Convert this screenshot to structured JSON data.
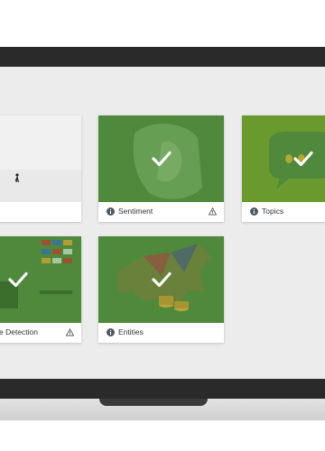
{
  "cards": [
    {
      "id": "scene",
      "label": "",
      "selected": false,
      "has_info": false,
      "has_warning": false
    },
    {
      "id": "sentiment",
      "label": "Sentiment",
      "selected": true,
      "has_info": true,
      "has_warning": true
    },
    {
      "id": "topics",
      "label": "Topics",
      "selected": true,
      "has_info": true,
      "has_warning": false
    },
    {
      "id": "image-detection",
      "label": "e Detection",
      "selected": true,
      "has_info": false,
      "has_warning": true
    },
    {
      "id": "entities",
      "label": "Entities",
      "selected": true,
      "has_info": true,
      "has_warning": false
    }
  ],
  "icons": {
    "check": "checkmark-icon",
    "info": "info-icon",
    "warning": "warning-icon"
  },
  "colors": {
    "selected_overlay": "#4f8a3c",
    "bezel": "#2a2a2a",
    "screen_bg": "#ececec"
  }
}
